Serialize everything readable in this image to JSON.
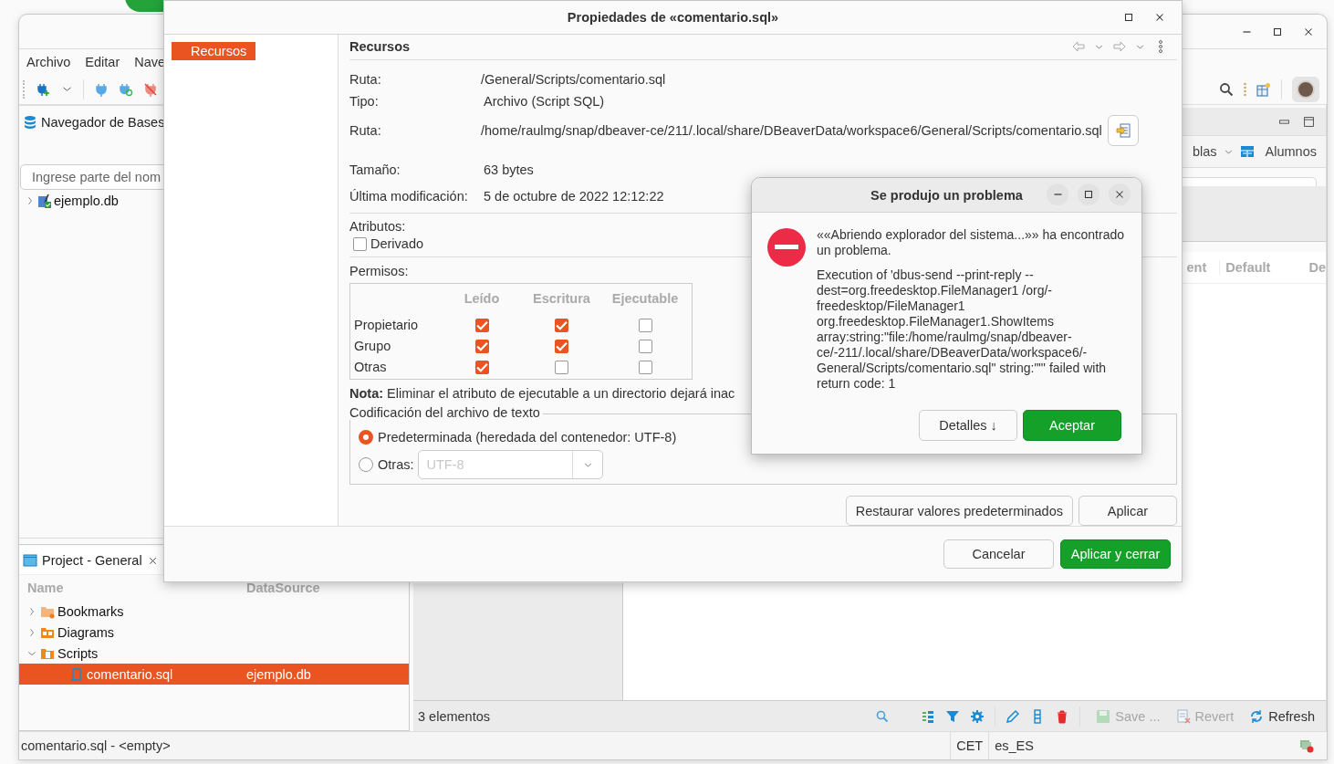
{
  "main_window": {
    "menu": [
      "Archivo",
      "Editar",
      "Nave"
    ],
    "navigator": {
      "title": "Navegador de Bases",
      "search": {
        "placeholder": "Ingrese parte del nom"
      },
      "tree": [
        {
          "label": "ejemplo.db",
          "expanded": false
        }
      ]
    },
    "editor_tabs": [
      "blas",
      "Alumnos"
    ],
    "columns": [
      "ent",
      "Default",
      "De"
    ],
    "project": {
      "title": "Project - General",
      "columns": [
        "Name",
        "DataSource"
      ],
      "tree": [
        {
          "label": "Bookmarks",
          "kind": "bookmarks",
          "expanded": false,
          "selected": false
        },
        {
          "label": "Diagrams",
          "kind": "diagrams",
          "expanded": false,
          "selected": false
        },
        {
          "label": "Scripts",
          "kind": "scripts",
          "expanded": true,
          "selected": false,
          "children": [
            {
              "label": "comentario.sql",
              "kind": "script",
              "datasource": "ejemplo.db",
              "selected": true
            }
          ]
        }
      ]
    },
    "results": {
      "count": "3 elementos",
      "actions": [
        {
          "label": "Save ...",
          "kind": "save",
          "disabled": true
        },
        {
          "label": "Revert",
          "kind": "revert",
          "disabled": true
        },
        {
          "label": "Refresh",
          "kind": "refresh",
          "disabled": false
        }
      ]
    },
    "status_bar": {
      "file": "comentario.sql - <empty>",
      "timezone": "CET",
      "locale": "es_ES"
    }
  },
  "properties_dialog": {
    "title": "Propiedades de «comentario.sql»",
    "nav": [
      {
        "label": "Recursos",
        "selected": true
      }
    ],
    "heading": "Recursos",
    "info": [
      {
        "label": "Ruta:",
        "value": "/General/Scripts/comentario.sql",
        "kind": "text"
      },
      {
        "label": "Tipo:",
        "value": "Archivo (Script SQL)",
        "kind": "text"
      },
      {
        "label": "Ruta:",
        "value": "/home/raulmg/snap/dbeaver-ce/211/.local/share/DBeaverData/workspace6/General/Scripts/comentario.sql",
        "kind": "location"
      },
      {
        "label": "Tamaño:",
        "value": "63 bytes",
        "kind": "text"
      },
      {
        "label": "Última modificación:",
        "value": "5 de octubre de 2022 12:12:22",
        "kind": "text"
      }
    ],
    "attributes_label": "Atributos:",
    "attributes": [
      {
        "label": "Derivado",
        "checked": false
      }
    ],
    "permissions_label": "Permisos:",
    "permission_columns": [
      "Leído",
      "Escritura",
      "Ejecutable"
    ],
    "permissions": [
      {
        "label": "Propietario",
        "cells": [
          {
            "checked": true
          },
          {
            "checked": true
          },
          {
            "checked": false
          }
        ]
      },
      {
        "label": "Grupo",
        "cells": [
          {
            "checked": true
          },
          {
            "checked": true
          },
          {
            "checked": false
          }
        ]
      },
      {
        "label": "Otras",
        "cells": [
          {
            "checked": true
          },
          {
            "checked": false
          },
          {
            "checked": false
          }
        ]
      }
    ],
    "note": "**Nota:** Eliminar el atributo de ejecutable a un directorio dejará inac",
    "encoding": {
      "legend": "Codificación del archivo de texto",
      "options": [
        {
          "label": "Predeterminada (heredada del contenedor: UTF-8)",
          "selected": true
        },
        {
          "label": "Otras:",
          "selected": false,
          "value": "UTF-8",
          "disabled": true
        }
      ]
    },
    "buttons": [
      "Restaurar valores predeterminados",
      "Aplicar"
    ],
    "footer_buttons": [
      {
        "label": "Cancelar",
        "kind": "secondary"
      },
      {
        "label": "Aplicar y cerrar",
        "kind": "primary"
      }
    ]
  },
  "error_dialog": {
    "title": "Se produjo un problema",
    "message": "««Abriendo explorador del sistema...»» ha encontrado un problema.",
    "details": "Execution of 'dbus-send --print-reply --dest=org.freedesktop.FileManager1 /org/-freedesktop/FileManager1 org.freedesktop.FileManager1.ShowItems array:string:\"file:/home/raulmg/snap/dbeaver-ce/-211/.local/share/DBeaverData/workspace6/-General/Scripts/comentario.sql\" string:\"\"' failed with return code: 1",
    "buttons": [
      {
        "label": "Detalles ↓",
        "kind": "secondary"
      },
      {
        "label": "Aceptar",
        "kind": "primary"
      }
    ]
  }
}
